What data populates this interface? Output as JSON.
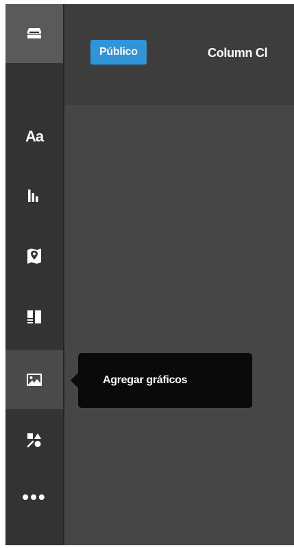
{
  "header": {
    "visibility_badge": "Público",
    "chart_title": "Column Cl"
  },
  "sidebar": {
    "items": [
      {
        "name": "storage-box-icon",
        "state": "active"
      },
      {
        "name": "text-icon",
        "label": "Aa"
      },
      {
        "name": "bar-chart-icon"
      },
      {
        "name": "map-pin-icon"
      },
      {
        "name": "layout-icon"
      },
      {
        "name": "image-icon",
        "state": "hover"
      },
      {
        "name": "shapes-icon"
      },
      {
        "name": "more-icon",
        "label": "•••"
      }
    ]
  },
  "tooltip": {
    "text": "Agregar gráficos"
  },
  "colors": {
    "accent": "#2f95d8",
    "sidebar_bg": "#333333",
    "canvas_bg": "#464646",
    "tooltip_bg": "#0a0a0a"
  }
}
